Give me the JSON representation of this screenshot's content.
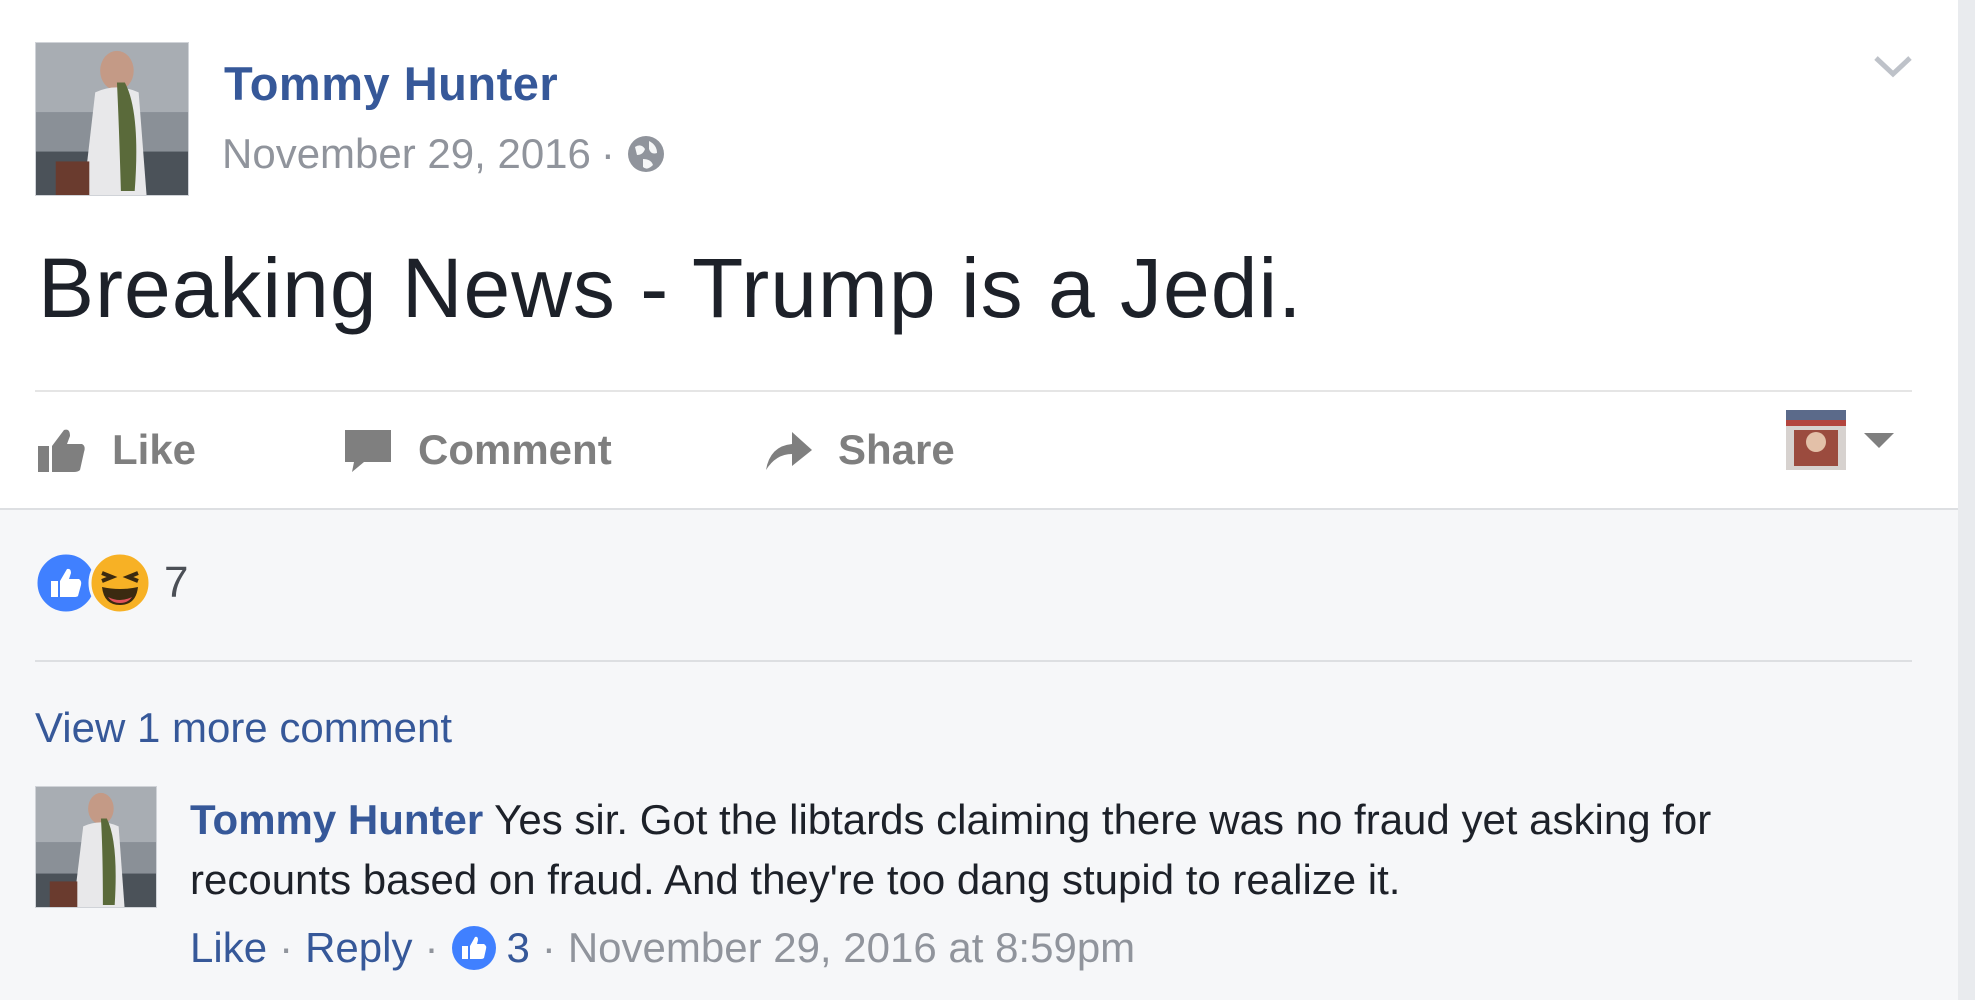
{
  "post": {
    "author": "Tommy Hunter",
    "date": "November 29, 2016",
    "dot": "·",
    "privacy_icon": "globe-icon",
    "text": "Breaking News - Trump is a Jedi."
  },
  "actions": {
    "like": "Like",
    "comment": "Comment",
    "share": "Share"
  },
  "reactions": {
    "types": [
      "like-reaction-icon",
      "haha-reaction-icon"
    ],
    "count": "7"
  },
  "comments": {
    "view_more": "View 1 more comment",
    "items": [
      {
        "author": "Tommy Hunter",
        "text": "Yes sir. Got the libtards claiming there was no fraud yet asking for recounts based on fraud. And they're too dang stupid to realize it.",
        "like_label": "Like",
        "reply_label": "Reply",
        "sep": "·",
        "likes": "3",
        "timestamp": "November 29, 2016 at 8:59pm"
      }
    ]
  },
  "colors": {
    "link_blue": "#365899",
    "meta_gray": "#90949c",
    "action_gray": "#7f7f7f",
    "feedback_bg": "#f6f7f9",
    "like_blue": "#4080ff",
    "haha_yellow": "#f7b125"
  }
}
